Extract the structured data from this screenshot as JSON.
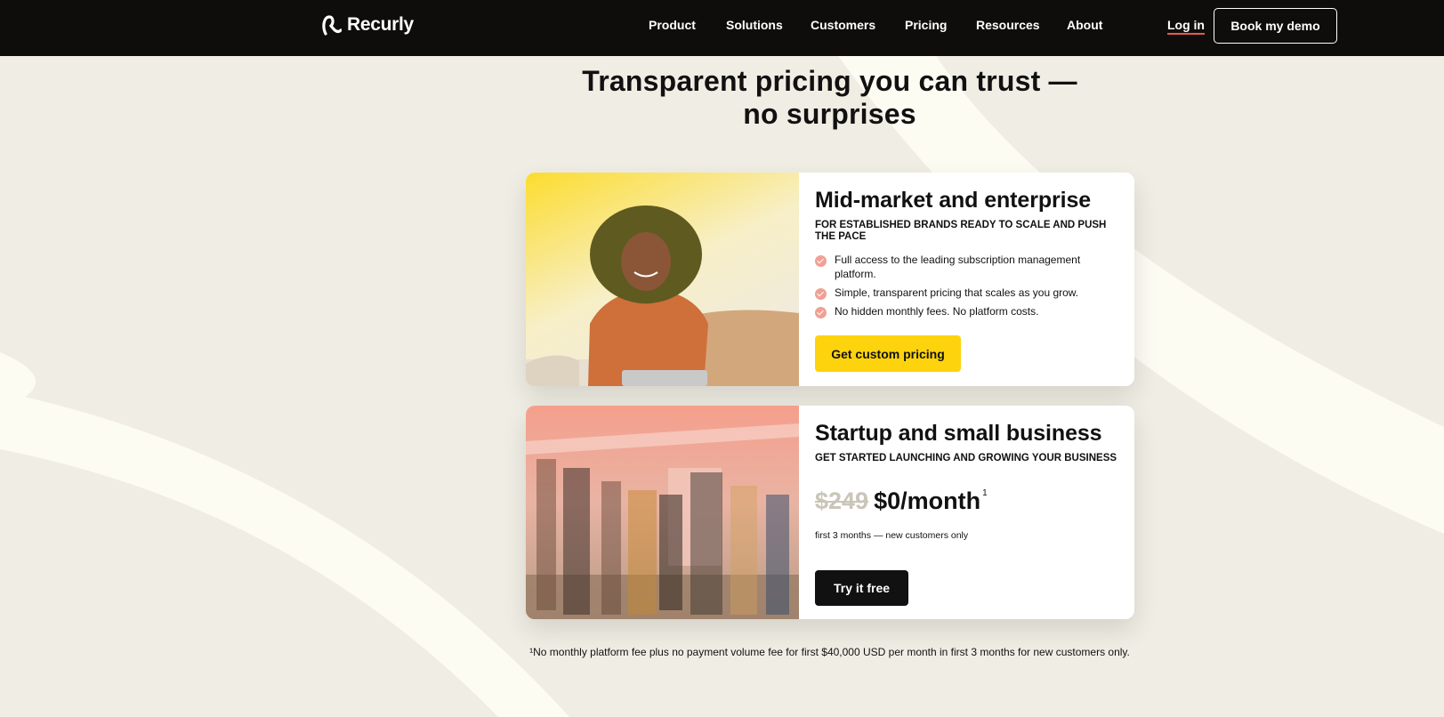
{
  "nav": {
    "brand": "Recurly",
    "items": [
      "Product",
      "Solutions",
      "Customers",
      "Pricing",
      "Resources",
      "About"
    ],
    "login": "Log in",
    "demo": "Book my demo"
  },
  "hero": {
    "line1": "Transparent pricing you can trust —",
    "line2": "no surprises"
  },
  "enterprise": {
    "title": "Mid-market and enterprise",
    "subtitle": "FOR ESTABLISHED BRANDS READY TO SCALE AND PUSH THE PACE",
    "bullets": [
      "Full access to the leading subscription management platform.",
      "Simple, transparent pricing that scales as you grow.",
      "No hidden monthly fees. No platform costs."
    ],
    "cta": "Get custom pricing"
  },
  "startup": {
    "title": "Startup and small business",
    "subtitle": "GET STARTED LAUNCHING AND GROWING YOUR BUSINESS",
    "old_price": "$249",
    "new_price": "$0/month",
    "superscript": "1",
    "note": "first 3 months — new customers only",
    "cta": "Try it free"
  },
  "footnote": "¹No monthly platform fee plus no payment volume fee for first $40,000 USD per month in first 3 months for new customers only.",
  "colors": {
    "page_bg": "#f0eee4",
    "nav_bg": "#0e0d0b",
    "accent_yellow": "#fdd30d",
    "check_pink": "#f0a094",
    "login_underline": "#e8594f"
  }
}
